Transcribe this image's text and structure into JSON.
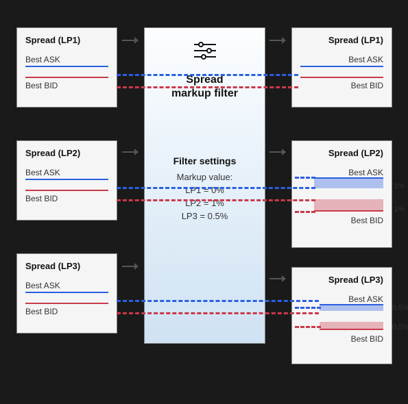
{
  "colors": {
    "ask": "#2a5fe0",
    "bid": "#c93a4a"
  },
  "left": [
    {
      "title": "Spread (LP1)",
      "ask": "Best ASK",
      "bid": "Best BID"
    },
    {
      "title": "Spread (LP2)",
      "ask": "Best ASK",
      "bid": "Best BID"
    },
    {
      "title": "Spread (LP3)",
      "ask": "Best ASK",
      "bid": "Best BID"
    }
  ],
  "right": [
    {
      "title": "Spread (LP1)",
      "ask": "Best ASK",
      "bid": "Best BID",
      "markup": ""
    },
    {
      "title": "Spread (LP2)",
      "ask": "Best ASK",
      "bid": "Best BID",
      "markup": "1%"
    },
    {
      "title": "Spread (LP3)",
      "ask": "Best ASK",
      "bid": "Best BID",
      "markup": "0.5%"
    }
  ],
  "mid": {
    "title_line1": "Spread",
    "title_line2": "markup filter",
    "settings_title": "Filter settings",
    "settings_sub": "Markup value:",
    "lines": [
      "LP1 = 0%",
      "LP2 = 1%",
      "LP3 = 0.5%"
    ]
  }
}
